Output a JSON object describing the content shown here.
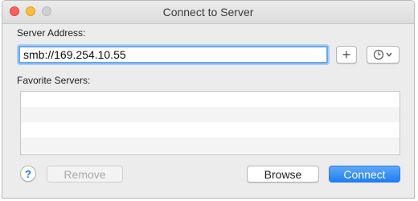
{
  "window": {
    "title": "Connect to Server"
  },
  "server_address": {
    "label": "Server Address:",
    "value": "smb://169.254.10.55"
  },
  "toolbar": {
    "add_label": "+",
    "recent_icon": "clock-icon",
    "recent_chevron": "chevron-down-icon"
  },
  "favorites": {
    "label": "Favorite Servers:",
    "items": []
  },
  "footer": {
    "help_label": "?",
    "remove_label": "Remove",
    "browse_label": "Browse",
    "connect_label": "Connect"
  },
  "colors": {
    "accent": "#1f7ef4",
    "close": "#fc605c",
    "minimize": "#fdbc40",
    "zoom_disabled": "#d0d0d0"
  }
}
